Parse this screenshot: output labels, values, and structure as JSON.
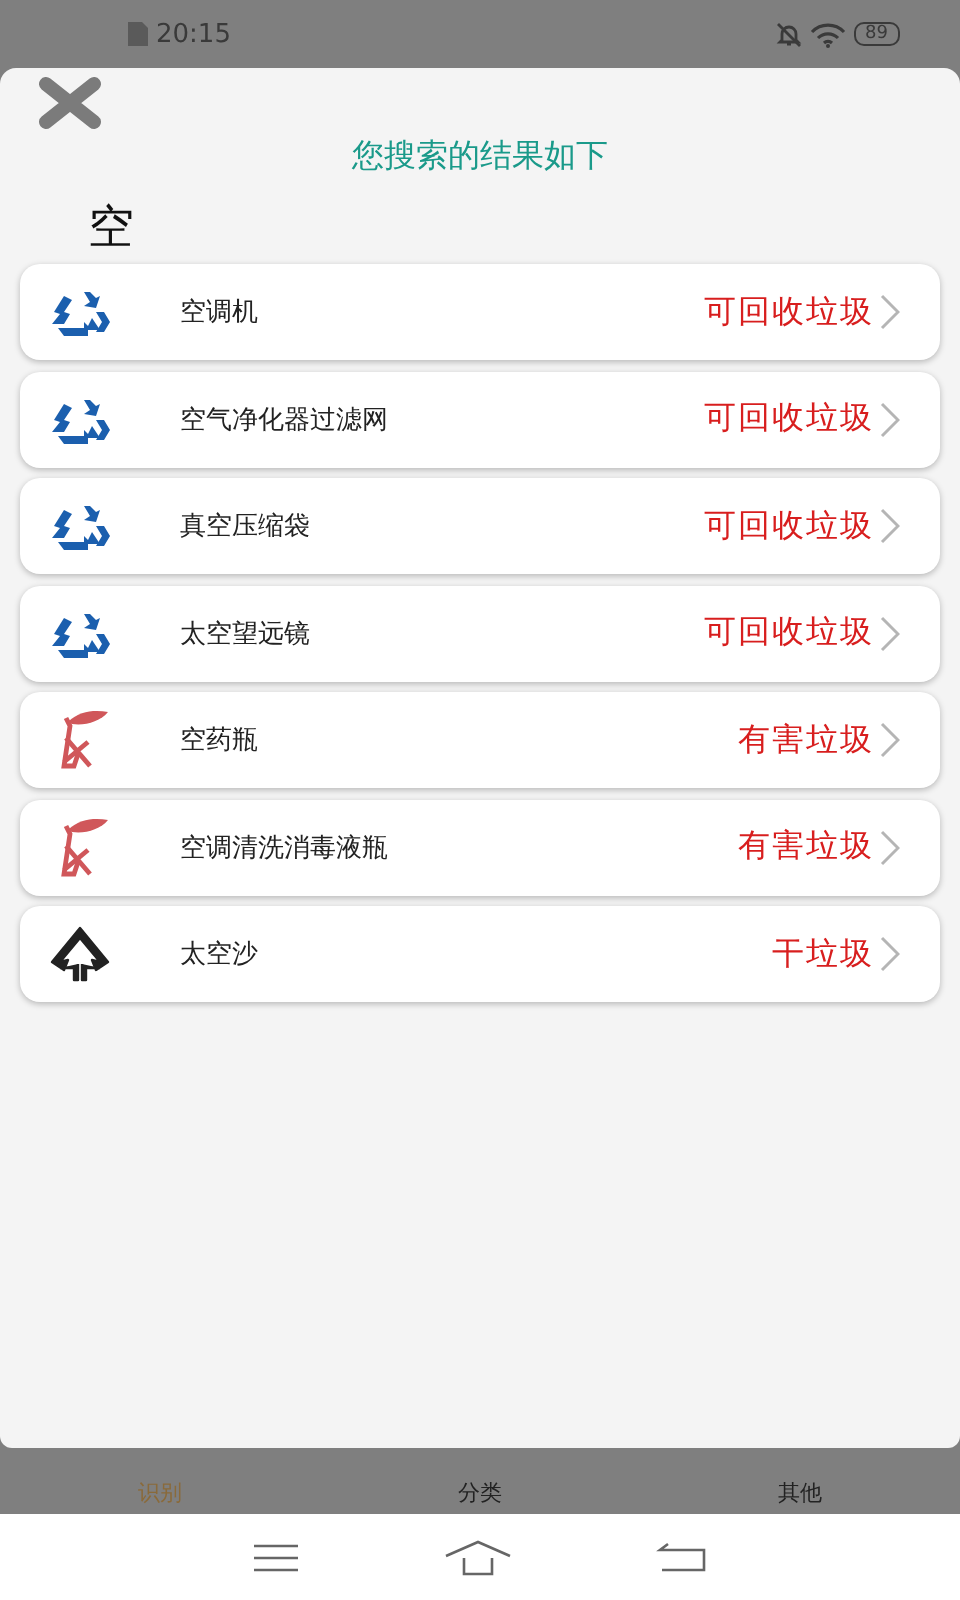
{
  "status_bar": {
    "time": "20:15",
    "battery": "89"
  },
  "sheet": {
    "title": "您搜索的结果如下",
    "query": "空"
  },
  "results": [
    {
      "name": "空调机",
      "category": "可回收垃圾",
      "kind": "recyclable"
    },
    {
      "name": "空气净化器过滤网",
      "category": "可回收垃圾",
      "kind": "recyclable"
    },
    {
      "name": "真空压缩袋",
      "category": "可回收垃圾",
      "kind": "recyclable"
    },
    {
      "name": "太空望远镜",
      "category": "可回收垃圾",
      "kind": "recyclable"
    },
    {
      "name": "空药瓶",
      "category": "有害垃圾",
      "kind": "hazardous"
    },
    {
      "name": "空调清洗消毒液瓶",
      "category": "有害垃圾",
      "kind": "hazardous"
    },
    {
      "name": "太空沙",
      "category": "干垃圾",
      "kind": "dry"
    }
  ],
  "tabs": [
    {
      "label": "识别",
      "selected": true
    },
    {
      "label": "分类",
      "selected": false
    },
    {
      "label": "其他",
      "selected": false
    }
  ]
}
